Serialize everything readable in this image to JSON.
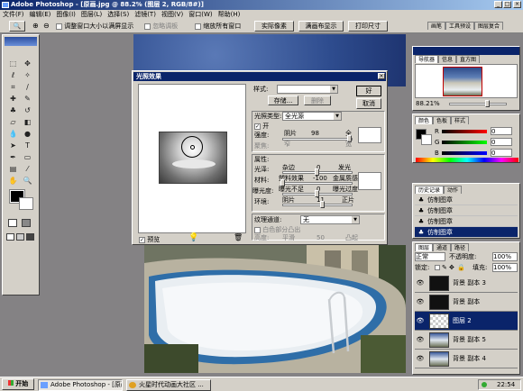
{
  "window": {
    "title": "Adobe Photoshop - [原画.jpg @ 88.2% (图层 2, RGB/8#)]"
  },
  "menu": [
    "文件(F)",
    "编辑(E)",
    "图像(I)",
    "图层(L)",
    "选择(S)",
    "滤镜(T)",
    "视图(V)",
    "窗口(W)",
    "帮助(H)"
  ],
  "options": {
    "resize_windows": "调整窗口大小以满屏显示",
    "ignore_palettes": "忽略调板",
    "zoom_all": "缩放所有窗口",
    "actual_pixels": "实际像素",
    "fit_on_screen": "满画布显示",
    "print_size": "打印尺寸",
    "palette_tabs": [
      "画笔",
      "工具预设",
      "图层复合"
    ]
  },
  "lighting": {
    "title": "光照效果",
    "style_label": "样式:",
    "store_label": "存储...",
    "delete_label": "删除",
    "ok_label": "好",
    "cancel_label": "取消",
    "light_type_label": "光照类型:",
    "light_type_value": "全光源",
    "on_label": "开",
    "intensity_label": "强度:",
    "intensity_left": "阴片",
    "intensity_value": "98",
    "intensity_right": "全",
    "focus_label": "聚焦:",
    "focus_left": "窄",
    "focus_right": "宽",
    "properties_label": "属性:",
    "gloss_label": "光泽:",
    "gloss_left": "杂边",
    "gloss_value": "0",
    "gloss_right": "发光",
    "material_label": "材料:",
    "material_left": "塑料效果",
    "material_value": "-100",
    "material_right": "金属质感",
    "exposure_label": "曝光度:",
    "exposure_left": "曝光不足",
    "exposure_value": "0",
    "exposure_right": "曝光过度",
    "ambience_label": "环境:",
    "ambience_left": "阴片",
    "ambience_value": "11",
    "ambience_right": "正片",
    "texture_label": "纹理通道:",
    "texture_value": "无",
    "white_high_label": "白色部分凸出",
    "height_label": "高度:",
    "height_left": "平滑",
    "height_value": "50",
    "height_right": "凸起",
    "preview_label": "预览"
  },
  "navigator": {
    "tabs": [
      "导航器",
      "信息",
      "直方图"
    ],
    "zoom": "88.21%"
  },
  "color_panel": {
    "tabs": [
      "颜色",
      "色板",
      "样式"
    ],
    "channels": [
      {
        "name": "R",
        "value": "0"
      },
      {
        "name": "G",
        "value": "0"
      },
      {
        "name": "B",
        "value": "0"
      }
    ]
  },
  "history": {
    "tabs": [
      "历史记录",
      "动作"
    ],
    "items": [
      "仿制图章",
      "仿制图章",
      "仿制图章",
      "仿制图章"
    ]
  },
  "layers": {
    "tabs": [
      "图层",
      "通道",
      "路径"
    ],
    "blend_mode": "正常",
    "opacity_label": "不透明度:",
    "opacity": "100%",
    "lock_label": "锁定:",
    "fill_label": "填充:",
    "fill": "100%",
    "items": [
      "背景 副本 3",
      "背景 副本",
      "图层 2",
      "背景 副本 5",
      "背景 副本 4"
    ]
  },
  "taskbar": {
    "start": "开始",
    "tasks": [
      "Adobe Photoshop - [原画...",
      "火星时代动画大社区 ..."
    ],
    "clock": "22:54"
  },
  "colors": {
    "title_active": "#0a246a",
    "face": "#d4d0c8",
    "workspace": "#848284",
    "selected": "#0a246a"
  }
}
